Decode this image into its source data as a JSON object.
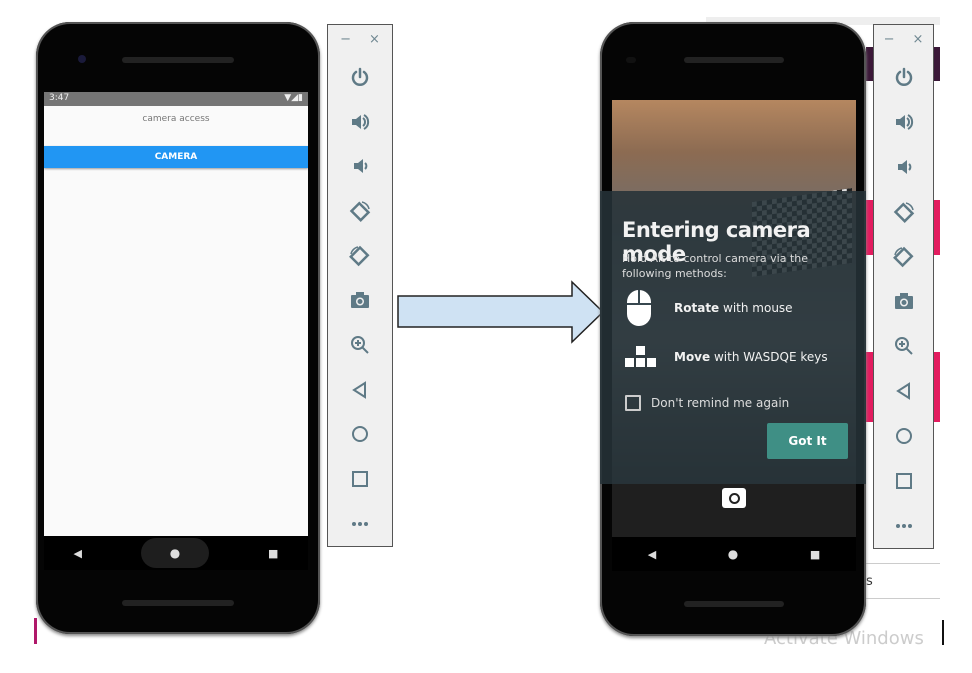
{
  "left_device": {
    "status_bar": {
      "time": "3:47"
    },
    "app": {
      "label": "camera access",
      "button_label": "CAMERA",
      "button_color": "#2196F3"
    }
  },
  "right_device": {
    "dialog": {
      "title": "Entering camera mode",
      "description": "Hold Alt to control camera via the following methods:",
      "methods": [
        {
          "bold": "Rotate",
          "text": " with mouse",
          "icon": "mouse-icon"
        },
        {
          "bold": "Move",
          "text": " with WASDQE keys",
          "icon": "keys-icon"
        }
      ],
      "checkbox_label": "Don't remind me again",
      "checkbox_checked": false,
      "button_label": "Got It",
      "button_color": "#3f8f85"
    }
  },
  "toolbar": {
    "minimize": "−",
    "close": "×",
    "icons": [
      "power-icon",
      "volume-up-icon",
      "volume-down-icon",
      "rotate-left-icon",
      "rotate-right-icon",
      "camera-icon",
      "zoom-icon",
      "back-icon",
      "home-icon",
      "overview-icon",
      "more-icon"
    ],
    "icon_color": "#5f7a86"
  },
  "background": {
    "watermark": "Activate Windows",
    "fragment": "s"
  }
}
